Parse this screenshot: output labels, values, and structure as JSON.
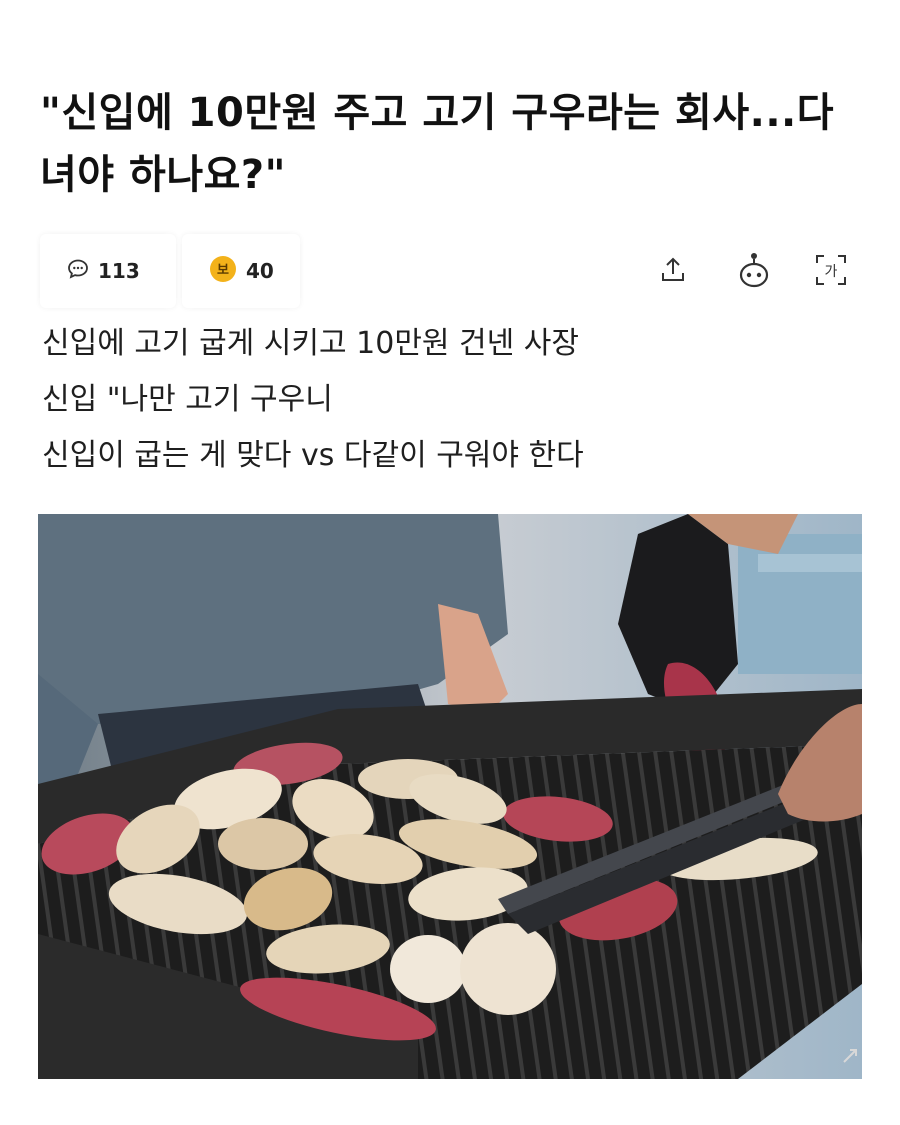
{
  "article": {
    "title": "\"신입에 10만원 주고 고기 구우라는 회사...다녀야 하나요?\"",
    "comment_count": "113",
    "reaction_count": "40",
    "reaction_badge_glyph": "보",
    "font_button_glyph": "가",
    "lines": [
      "신입에 고기 굽게 시키고 10만원 건넨 사장",
      "신입 \"나만 고기 구우니",
      "신입이 굽는 게 맞다 vs 다같이 구워야 한다"
    ]
  },
  "icons": {
    "comments": "speech-bubble-icon",
    "reactions": "reaction-face-icon",
    "share": "share-upload-icon",
    "bot": "robot-face-icon",
    "font_size": "font-size-icon",
    "expand": "expand-arrows-icon"
  },
  "colors": {
    "reaction_badge": "#f3b21a",
    "text": "#1f1f1f",
    "grill": "#1c1c1c",
    "raw_meat": "#b5485a",
    "chicken": "#e8ddc6"
  }
}
